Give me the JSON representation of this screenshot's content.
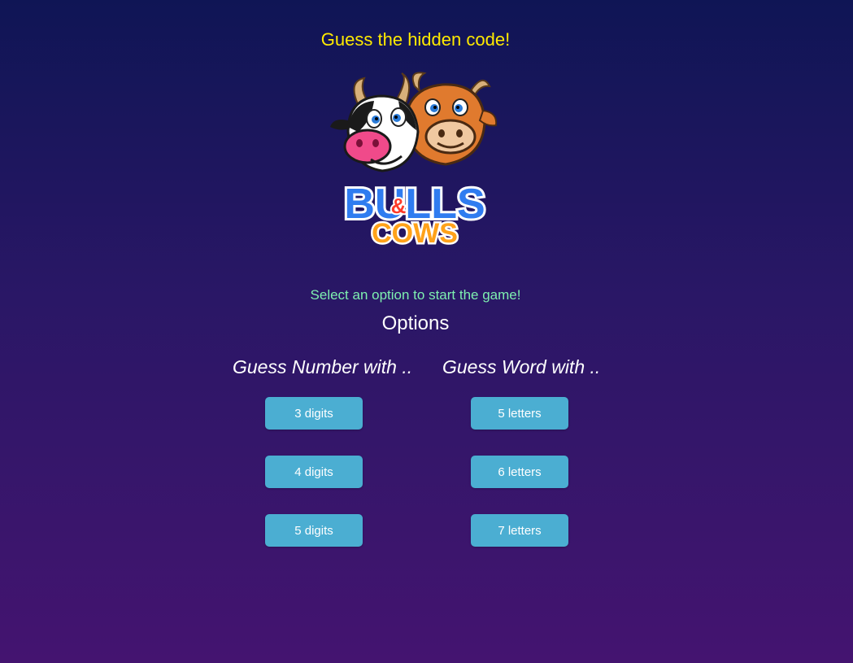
{
  "header": {
    "subtitle": "Guess the hidden code!"
  },
  "logo": {
    "line1": "BULLS",
    "amp": "&",
    "line2": "COWS"
  },
  "menu": {
    "prompt": "Select an option to start the game!",
    "options_title": "Options",
    "number_column": {
      "title": "Guess Number with ..",
      "buttons": [
        "3 digits",
        "4 digits",
        "5 digits"
      ]
    },
    "word_column": {
      "title": "Guess Word with ..",
      "buttons": [
        "5 letters",
        "6 letters",
        "7 letters"
      ]
    }
  },
  "colors": {
    "subtitle": "#ffea00",
    "prompt": "#7ef0b0",
    "button_bg": "#4baed2"
  }
}
